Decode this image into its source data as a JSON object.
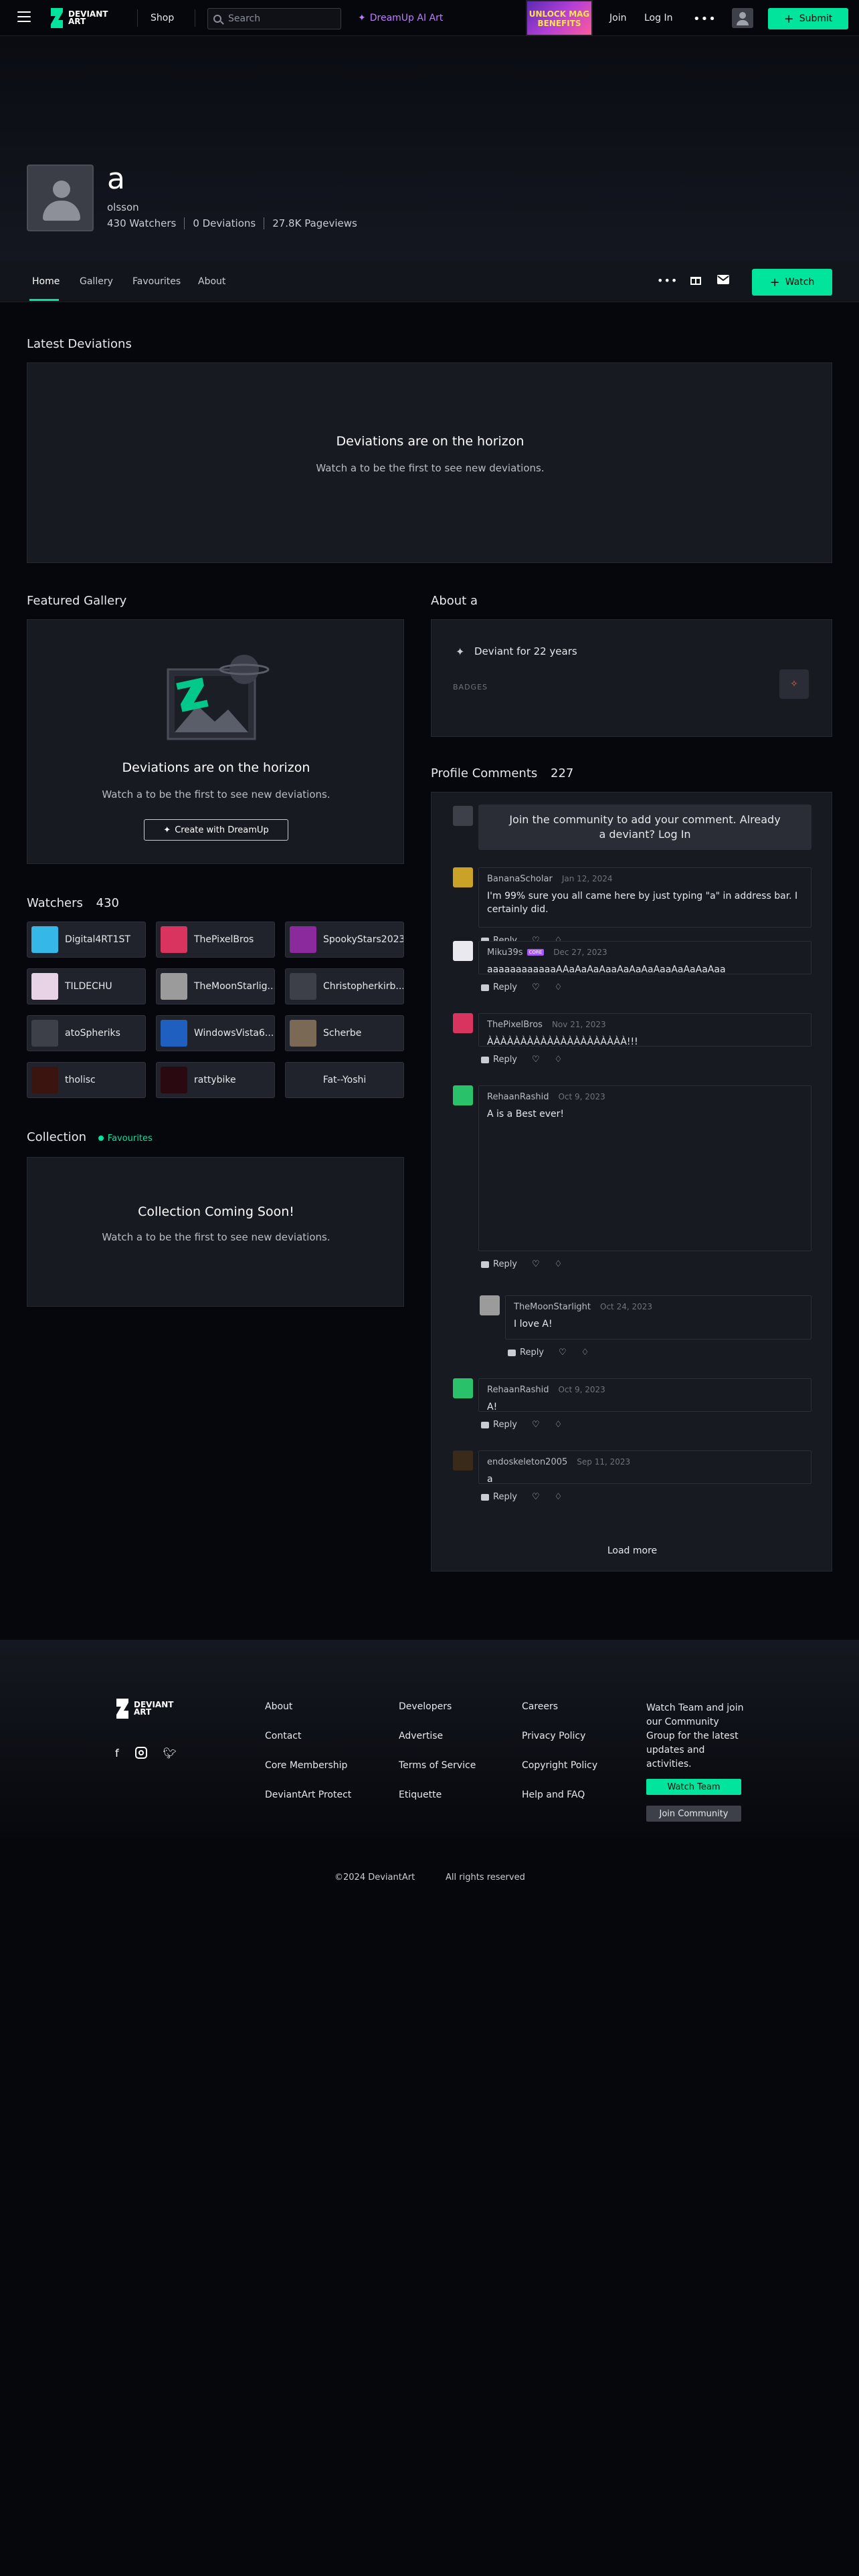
{
  "topbar": {
    "logo_text": "DEVIANT ART",
    "shop": "Shop",
    "search_placeholder": "Search",
    "dreamup": "DreamUp AI Art",
    "ad_text": "UNLOCK MAG BENEFITS",
    "join": "Join",
    "login": "Log In",
    "more": "•••",
    "submit": "Submit"
  },
  "profile": {
    "username": "a",
    "realname": "olsson",
    "watchers": "430 Watchers",
    "deviations": "0 Deviations",
    "pageviews": "27.8K Pageviews"
  },
  "tabs": [
    "Home",
    "Gallery",
    "Favourites",
    "About"
  ],
  "watch_button": "Watch",
  "latest": {
    "heading": "Latest Deviations",
    "title": "Deviations are on the horizon",
    "subtitle": "Watch a to be the first to see new deviations."
  },
  "featured": {
    "heading": "Featured Gallery",
    "title": "Deviations are on the horizon",
    "subtitle": "Watch a to be the first to see new deviations.",
    "cta": "Create with DreamUp"
  },
  "watchers": {
    "heading": "Watchers",
    "count": "430",
    "items": [
      {
        "name": "Digital4RT1ST",
        "color": "#35b8e8"
      },
      {
        "name": "ThePixelBros",
        "color": "#d8345f"
      },
      {
        "name": "SpookyStars2023",
        "color": "#8a2a9c"
      },
      {
        "name": "TILDECHU",
        "color": "#e8d3e6"
      },
      {
        "name": "TheMoonStarlig...",
        "color": "#9b9b9b"
      },
      {
        "name": "Christopherkirb...",
        "color": "#3d4049"
      },
      {
        "name": "atoSpheriks",
        "color": "#3d4049"
      },
      {
        "name": "WindowsVista6...",
        "color": "#1f5fbf"
      },
      {
        "name": "Scherbe",
        "color": "#7a6a55"
      },
      {
        "name": "tholisc",
        "color": "#3a1510"
      },
      {
        "name": "rattybike",
        "color": "#2a0a10"
      },
      {
        "name": "Fat--Yoshi",
        "color": ""
      }
    ]
  },
  "collection": {
    "heading": "Collection",
    "chip": "Favourites",
    "title": "Collection Coming Soon!",
    "subtitle": "Watch a to be the first to see new deviations."
  },
  "about": {
    "heading": "About a",
    "deviant_for": "Deviant for 22 years",
    "badges": "BADGES"
  },
  "comments": {
    "heading": "Profile Comments",
    "count": "227",
    "join_prompt": "Join the community to add your comment. Already a deviant? Log In",
    "reply": "Reply",
    "load_more": "Load more",
    "items": [
      {
        "name": "BananaScholar",
        "date": "Jan 12, 2024",
        "text": "I'm 99% sure you all came here by just typing \"a\" in address bar. I certainly did.",
        "color": "#c9a227"
      },
      {
        "name": "Miku39s",
        "date": "Dec 27, 2023",
        "text": "aaaaaaaaaaaaAAaAaAaAaaAaAaAaAaaAaAaAaAaa",
        "color": "#e9e9ef",
        "badge": "CORE"
      },
      {
        "name": "ThePixelBros",
        "date": "Nov 21, 2023",
        "text": "ÀÀÀÀÀÀÀÀÀÀÀÀÀÀÀÀÀÀÀÀÀ!!!",
        "color": "#d8345f"
      },
      {
        "name": "RehaanRashid",
        "date": "Oct 9, 2023",
        "text": "A is a Best ever!",
        "color": "#29c26a"
      },
      {
        "name": "TheMoonStarlight",
        "date": "Oct 24, 2023",
        "text": "I love A!",
        "color": "#9b9b9b"
      },
      {
        "name": "RehaanRashid",
        "date": "Oct 9, 2023",
        "text": "A!",
        "color": "#29c26a"
      },
      {
        "name": "endoskeleton2005",
        "date": "Sep 11, 2023",
        "text": "a",
        "color": "#3a2a1a"
      }
    ]
  },
  "footer": {
    "logo_text": "DEVIANT ART",
    "col1": [
      "About",
      "Contact",
      "Core Membership",
      "DeviantArt Protect"
    ],
    "col2": [
      "Developers",
      "Advertise",
      "Terms of Service",
      "Etiquette"
    ],
    "col3": [
      "Careers",
      "Privacy Policy",
      "Copyright Policy",
      "Help and FAQ"
    ],
    "team_text": "Watch Team and join our Community Group for the latest updates and activities.",
    "watch_team": "Watch Team",
    "join_community": "Join Community",
    "copyright": "©2024 DeviantArt",
    "rights": "All rights reserved"
  },
  "colors": {
    "accent": "#00e59b",
    "background": "#06070d",
    "panel": "#181a21"
  }
}
